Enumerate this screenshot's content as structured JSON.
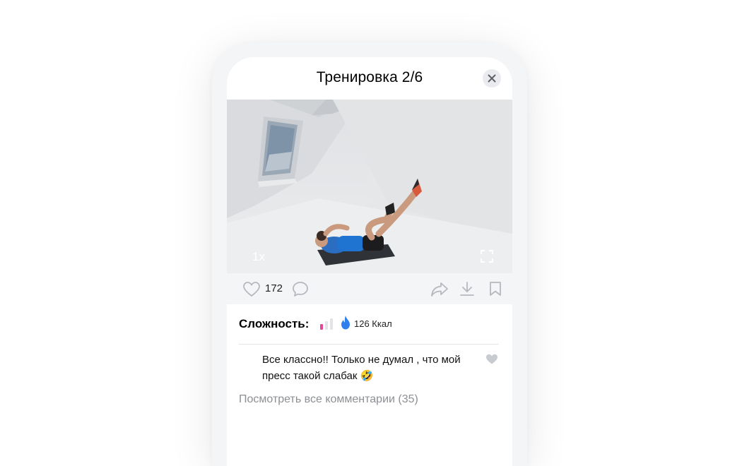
{
  "header": {
    "title": "Тренировка 2/6",
    "close_icon": "close-icon"
  },
  "video": {
    "speed_label": "1x",
    "fullscreen_icon": "fullscreen-icon"
  },
  "actions": {
    "like_icon": "heart-outline-icon",
    "likes_count": "172",
    "comment_icon": "comment-bubble-icon",
    "share_icon": "share-arrow-icon",
    "download_icon": "download-icon",
    "bookmark_icon": "bookmark-icon"
  },
  "workout": {
    "difficulty_label": "Сложность:",
    "difficulty_level": 1,
    "difficulty_max": 3,
    "calories_icon": "flame-icon",
    "calories": "126 Ккал"
  },
  "comments": {
    "items": [
      {
        "text": "Все классно!! Только не думал , что мой пресс такой слабак 🤣",
        "like_icon": "heart-filled-icon"
      }
    ],
    "view_all_label": "Посмотреть все комментарии (35)"
  },
  "colors": {
    "accent_blue": "#2f80ed",
    "difficulty_active": "#e5489b",
    "icon_gray": "#b5b8be"
  }
}
